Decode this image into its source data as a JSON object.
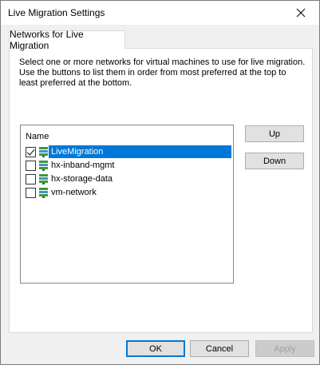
{
  "window": {
    "title": "Live Migration Settings",
    "close_glyph": "✕"
  },
  "tab": {
    "label": "Networks for Live Migration"
  },
  "description": "Select one or more networks for virtual machines to use for live migration. Use the buttons to list them in order from most preferred at the top to least preferred at the bottom.",
  "list": {
    "header": "Name",
    "items": [
      {
        "label": "LiveMigration",
        "checked": true,
        "selected": true
      },
      {
        "label": "hx-inband-mgmt",
        "checked": false,
        "selected": false
      },
      {
        "label": "hx-storage-data",
        "checked": false,
        "selected": false
      },
      {
        "label": "vm-network",
        "checked": false,
        "selected": false
      }
    ]
  },
  "side_buttons": {
    "up": "Up",
    "down": "Down"
  },
  "footer": {
    "ok": "OK",
    "cancel": "Cancel",
    "apply": "Apply"
  },
  "colors": {
    "selection": "#0078d7",
    "icon_green": "#3a9a3a",
    "icon_blue": "#4a90c8"
  }
}
